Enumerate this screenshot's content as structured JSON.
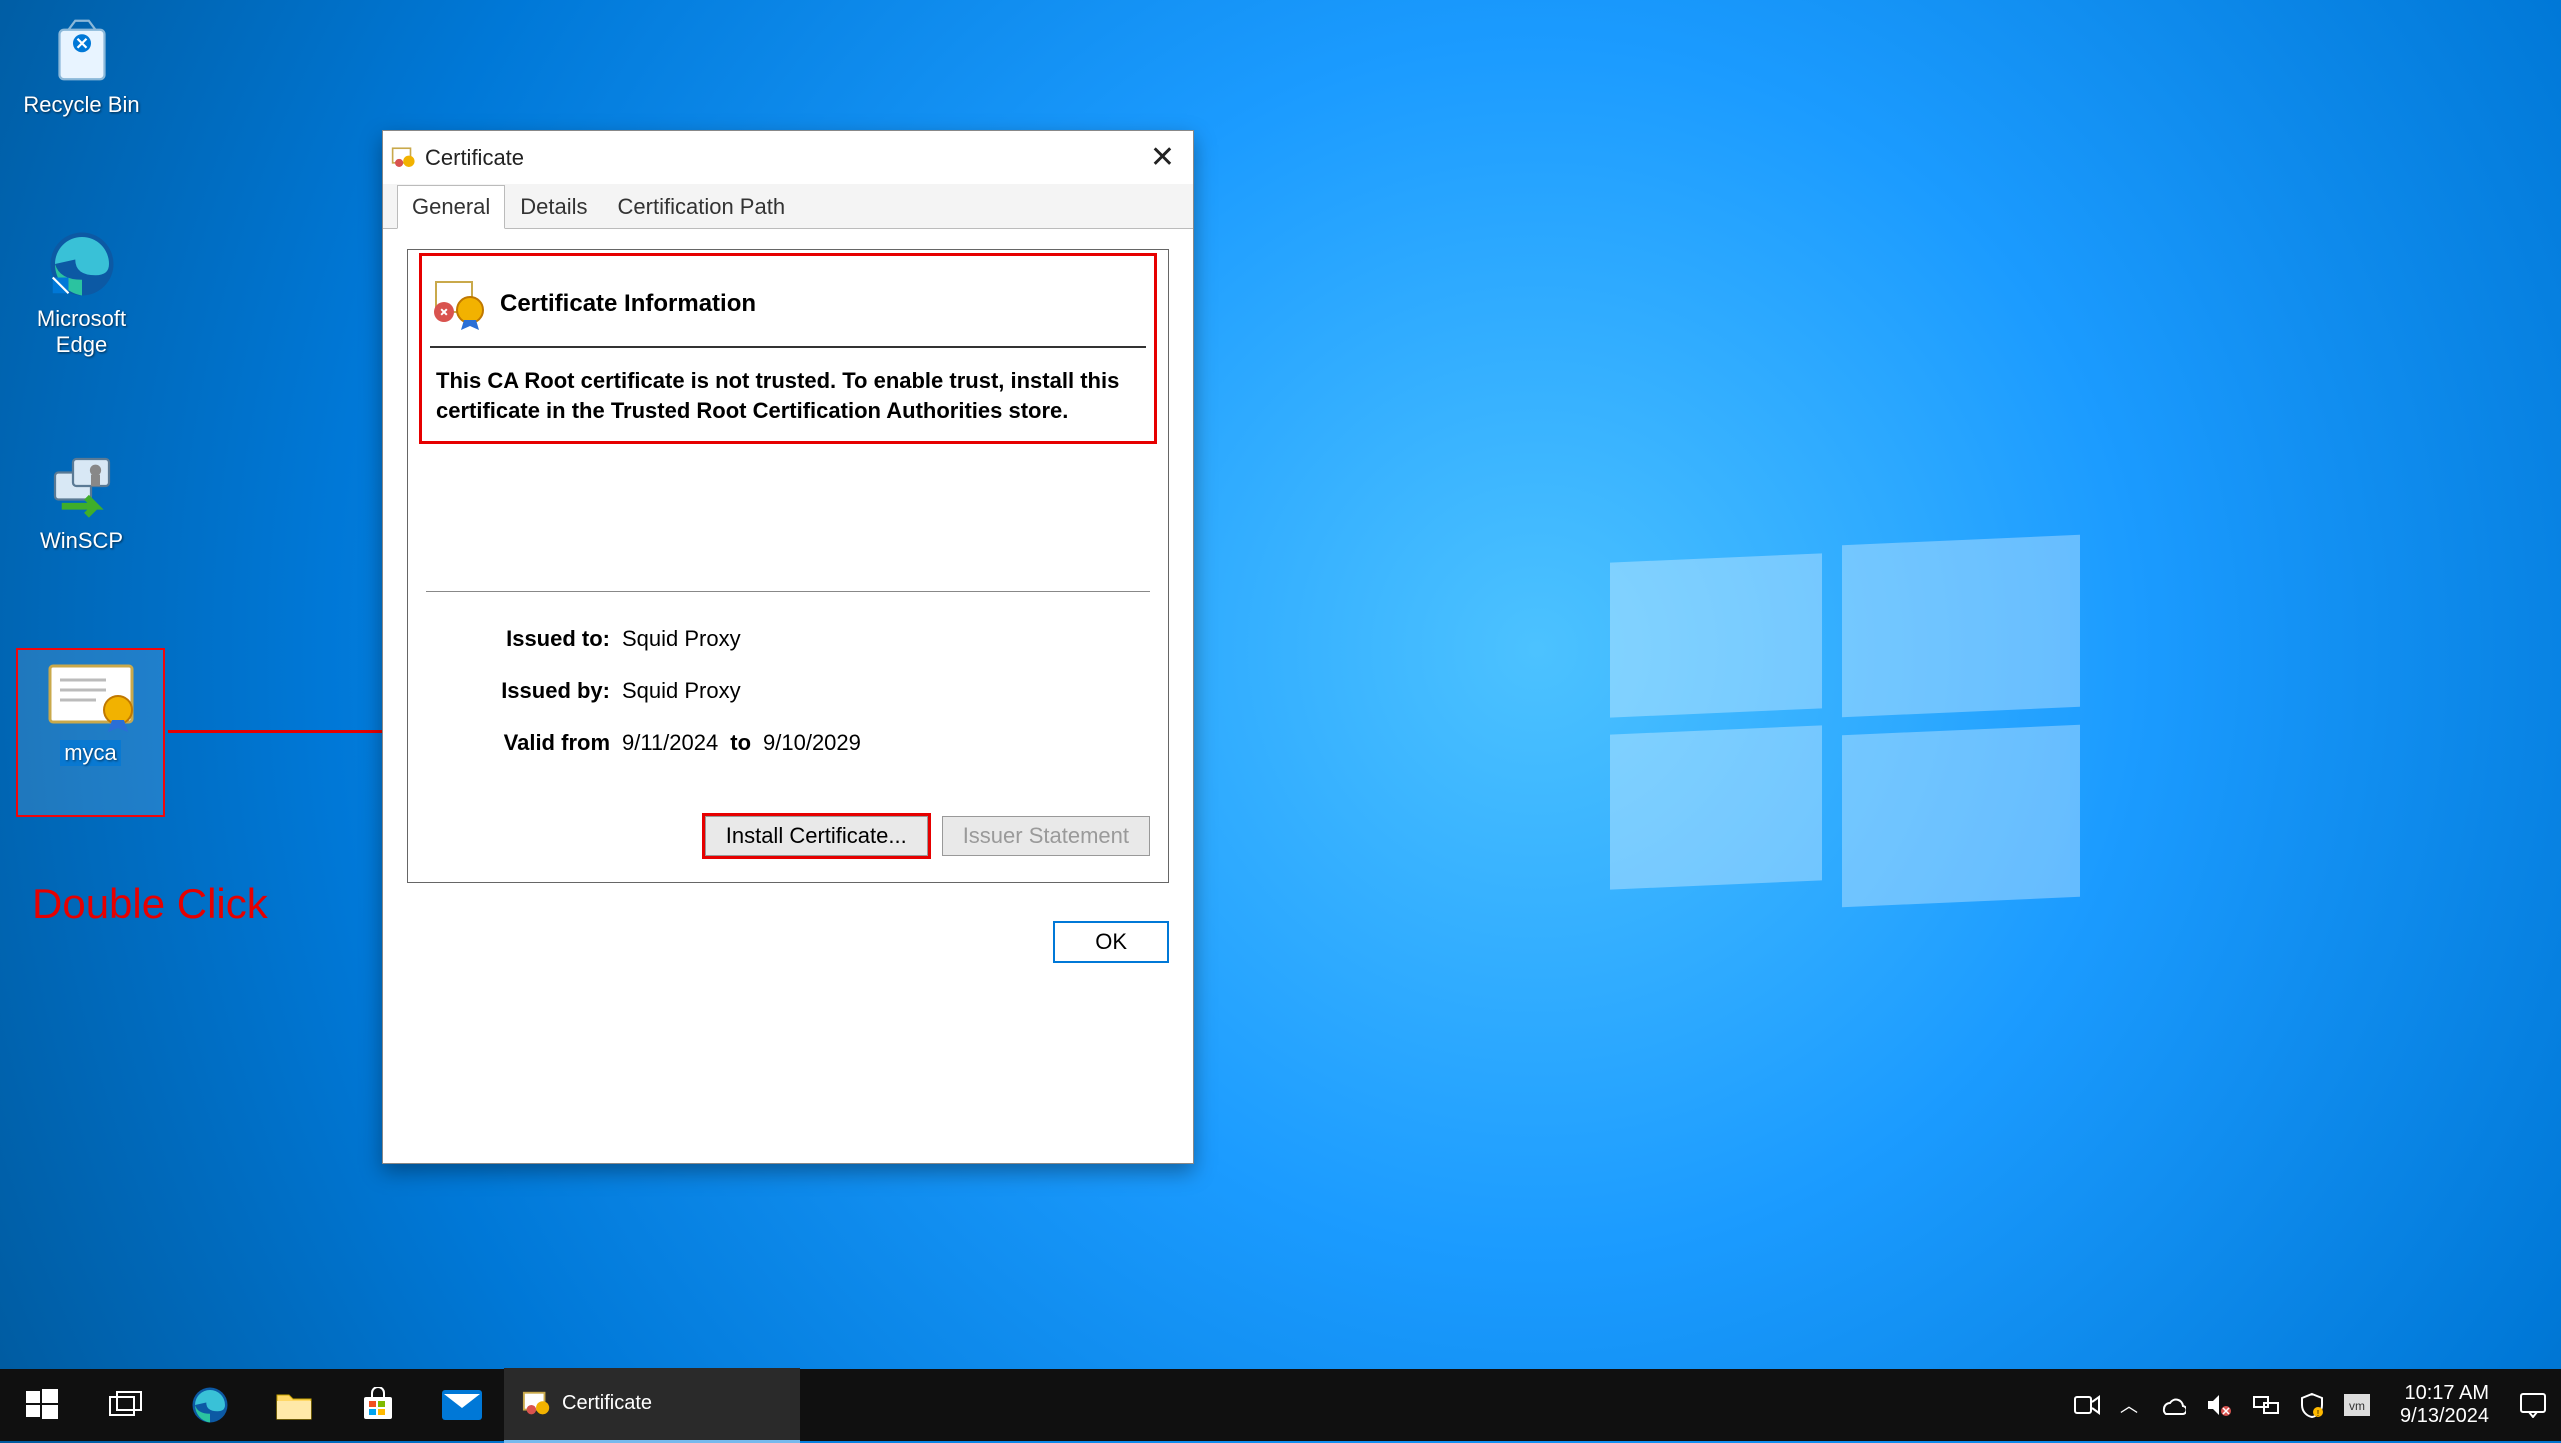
{
  "desktop": {
    "icons": [
      {
        "label": "Recycle Bin"
      },
      {
        "label": "Microsoft Edge"
      },
      {
        "label": "WinSCP"
      },
      {
        "label": "myca",
        "selected": true
      }
    ]
  },
  "annotations": {
    "double_click": "Double Click"
  },
  "cert_window": {
    "title": "Certificate",
    "tabs": {
      "general": "General",
      "details": "Details",
      "path": "Certification Path"
    },
    "info_heading": "Certificate Information",
    "trust_msg": "This CA Root certificate is not trusted. To enable trust, install this certificate in the Trusted Root Certification Authorities store.",
    "issued_to_label": "Issued to:",
    "issued_to_value": "Squid Proxy",
    "issued_by_label": "Issued by:",
    "issued_by_value": "Squid Proxy",
    "valid_from_label": "Valid from",
    "valid_from_value": "9/11/2024",
    "valid_to_label": "to",
    "valid_to_value": "9/10/2029",
    "install_btn": "Install Certificate...",
    "issuer_btn": "Issuer Statement",
    "ok_btn": "OK"
  },
  "taskbar": {
    "app_label": "Certificate",
    "time": "10:17 AM",
    "date": "9/13/2024"
  }
}
